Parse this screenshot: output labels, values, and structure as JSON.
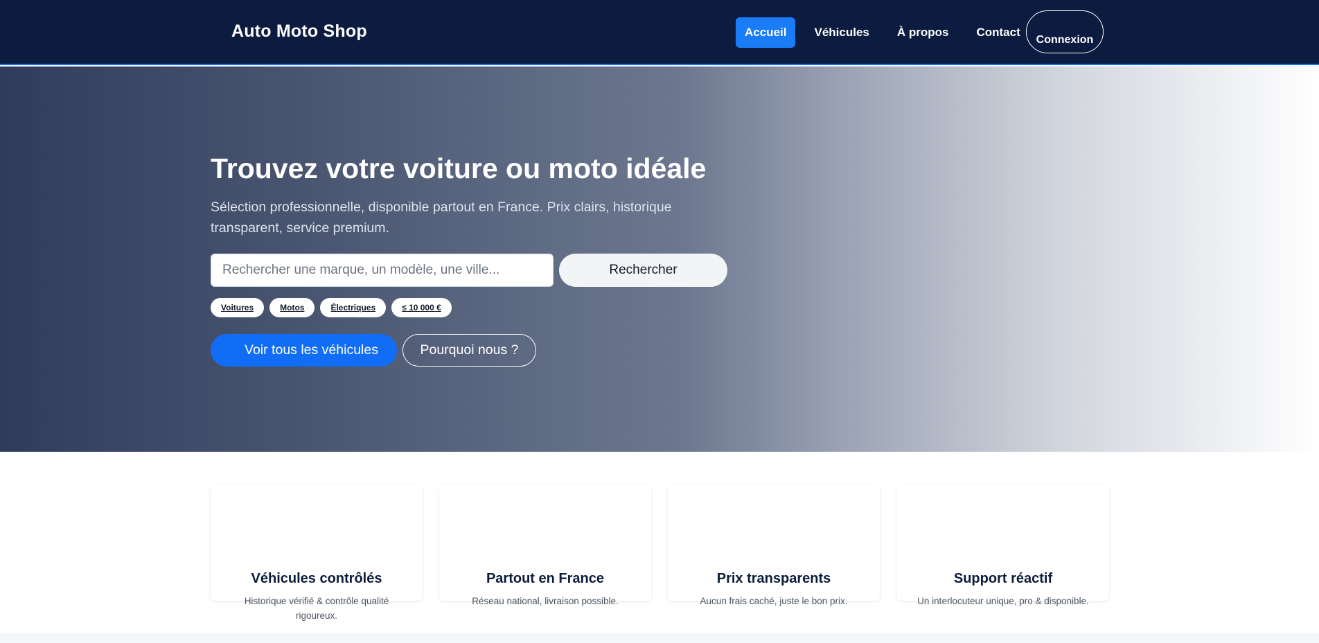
{
  "navbar": {
    "brand": "Auto Moto Shop",
    "links": [
      {
        "label": "Accueil",
        "active": true
      },
      {
        "label": "Véhicules",
        "active": false
      },
      {
        "label": "À propos",
        "active": false
      },
      {
        "label": "Contact",
        "active": false
      }
    ],
    "login_label": "Connexion",
    "background_color": "#0b1c40",
    "accent_color": "#1b7cf8"
  },
  "hero": {
    "title": "Trouvez votre voiture ou moto idéale",
    "subtitle": "Sélection professionnelle, disponible partout en France. Prix clairs, historique transparent, service premium.",
    "search": {
      "placeholder": "Rechercher une marque, un modèle, une ville...",
      "value": "",
      "button_label": "Rechercher"
    },
    "chips": [
      "Voitures",
      "Motos",
      "Électriques",
      "≤ 10 000 €"
    ],
    "cta_primary": "Voir tous les véhicules",
    "cta_secondary": "Pourquoi nous ?",
    "primary_color": "#116df6"
  },
  "features": [
    {
      "title": "Véhicules contrôlés",
      "description": "Historique vérifié & contrôle qualité rigoureux."
    },
    {
      "title": "Partout en France",
      "description": "Réseau national, livraison possible."
    },
    {
      "title": "Prix transparents",
      "description": "Aucun frais caché, juste le bon prix."
    },
    {
      "title": "Support réactif",
      "description": "Un interlocuteur unique, pro & disponible."
    }
  ]
}
